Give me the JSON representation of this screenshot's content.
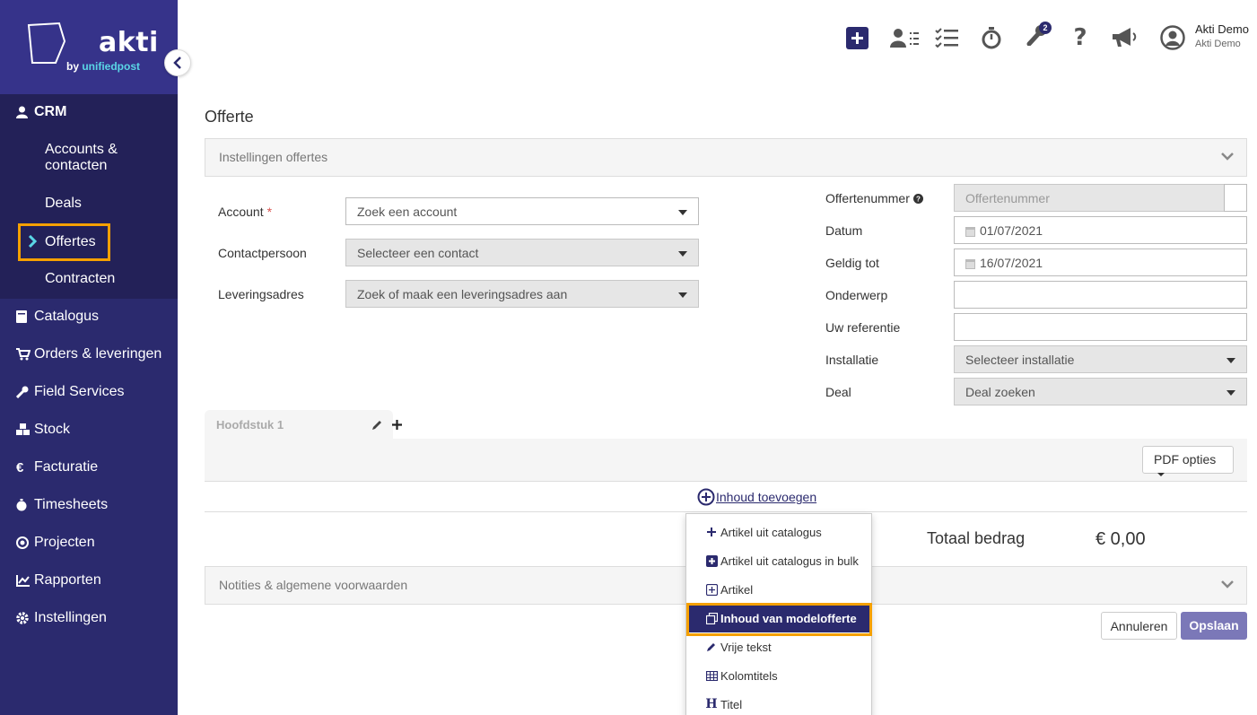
{
  "brand": {
    "name": "akti",
    "by": "by ",
    "company": "unifiedpost"
  },
  "sidebar": {
    "crm": "CRM",
    "crm_items": [
      "Accounts &",
      "contacten",
      "Deals",
      "Offertes",
      "Contracten"
    ],
    "items": [
      "Catalogus",
      "Orders & leveringen",
      "Field Services",
      "Stock",
      "Facturatie",
      "Timesheets",
      "Projecten",
      "Rapporten",
      "Instellingen"
    ]
  },
  "topbar": {
    "notification_count": "2",
    "user_name": "Akti Demo",
    "user_company": "Akti Demo",
    "icons": [
      "plus-square-icon",
      "contacts-list-icon",
      "checklist-icon",
      "stopwatch-icon",
      "wrench-icon",
      "help-icon",
      "megaphone-icon",
      "user-avatar-icon"
    ]
  },
  "page": {
    "title": "Offerte",
    "settings_panel": "Instellingen offertes",
    "notes_panel": "Notities & algemene voorwaarden"
  },
  "form_left": {
    "account_label": "Account",
    "account_required": "*",
    "account_placeholder": "Zoek een account",
    "contact_label": "Contactpersoon",
    "contact_placeholder": "Selecteer een contact",
    "address_label": "Leveringsadres",
    "address_placeholder": "Zoek of maak een leveringsadres aan"
  },
  "form_right": {
    "number_label": "Offertenummer",
    "number_placeholder": "Offertenummer",
    "date_label": "Datum",
    "date_value": "01/07/2021",
    "valid_label": "Geldig tot",
    "valid_value": "16/07/2021",
    "subject_label": "Onderwerp",
    "reference_label": "Uw referentie",
    "installation_label": "Installatie",
    "installation_placeholder": "Selecteer installatie",
    "deal_label": "Deal",
    "deal_placeholder": "Deal zoeken"
  },
  "chapter": {
    "name": "Hoofdstuk 1",
    "pdf_options": "PDF opties"
  },
  "add_content": "Inhoud toevoegen",
  "totals": {
    "label": "Totaal bedrag",
    "value": "€ 0,00"
  },
  "actions": {
    "cancel": "Annuleren",
    "save": "Opslaan"
  },
  "dropdown": {
    "items": [
      "Artikel uit catalogus",
      "Artikel uit catalogus in bulk",
      "Artikel",
      "Inhoud van modelofferte",
      "Vrije tekst",
      "Kolomtitels",
      "Titel"
    ],
    "active_index": 3
  },
  "colors": {
    "sidebar": "#2b2a6e",
    "accent": "#2b2a6e",
    "highlight": "#f5a000",
    "save": "#7b78b8",
    "cyan": "#5ad6e6"
  }
}
